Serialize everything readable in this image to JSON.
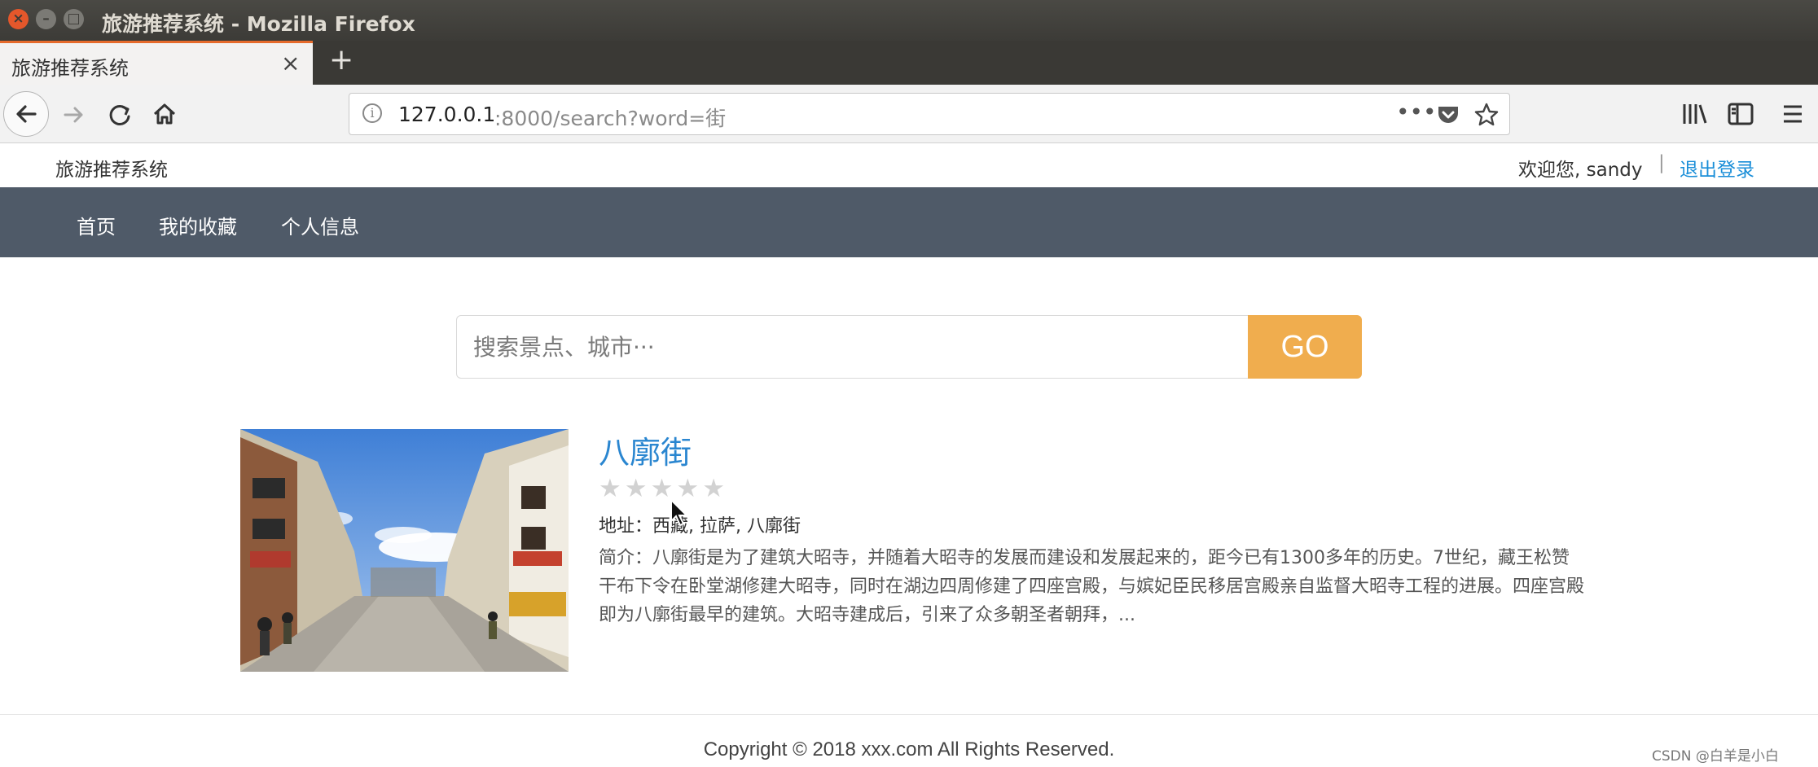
{
  "window": {
    "title": "旅游推荐系统 - Mozilla Firefox"
  },
  "tab": {
    "label": "旅游推荐系统",
    "close": "×",
    "new_tab": "+"
  },
  "urlbar": {
    "host": "127.0.0.1",
    "path": ":8000/search?word=街",
    "info": "i",
    "more": "•••"
  },
  "header": {
    "site_name": "旅游推荐系统",
    "welcome": "欢迎您, sandy",
    "separator": "|",
    "logout": "退出登录"
  },
  "nav": {
    "items": [
      {
        "label": "首页"
      },
      {
        "label": "我的收藏"
      },
      {
        "label": "个人信息"
      }
    ]
  },
  "search": {
    "placeholder": "搜索景点、城市···",
    "button": "GO"
  },
  "results": [
    {
      "title": "八廓街",
      "rating": 0,
      "rating_max": 5,
      "address": "地址：西藏, 拉萨, 八廓街",
      "description": "简介：八廓街是为了建筑大昭寺，并随着大昭寺的发展而建设和发展起来的，距今已有1300多年的历史。7世纪，藏王松赞干布下令在卧堂湖修建大昭寺，同时在湖边四周修建了四座宫殿，与嫔妃臣民移居宫殿亲自监督大昭寺工程的进展。四座宫殿即为八廓街最早的建筑。大昭寺建成后，引来了众多朝圣者朝拜，..."
    }
  ],
  "footer": {
    "copyright": "Copyright © 2018 xxx.com All Rights Reserved."
  },
  "watermark": "CSDN @白羊是小白",
  "colors": {
    "nav_bg": "#4f5a68",
    "go_button": "#f0ad4e",
    "link": "#1a8ed8",
    "title": "#2a86d0",
    "tab_accent": "#e66b2c"
  }
}
